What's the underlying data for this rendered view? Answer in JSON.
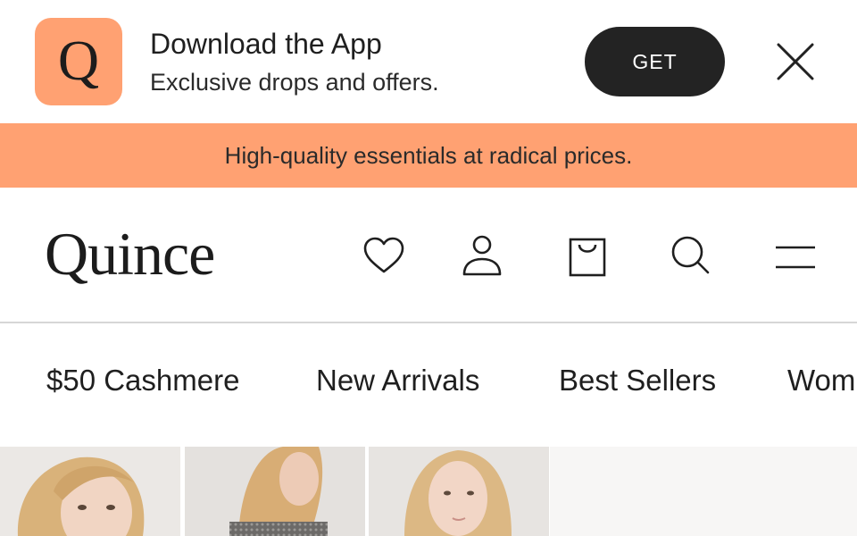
{
  "app_banner": {
    "logo_letter": "Q",
    "title": "Download the App",
    "subtitle": "Exclusive drops and offers.",
    "get_label": "GET",
    "accent_color": "#ffa172"
  },
  "promo": {
    "text": "High-quality essentials at radical prices."
  },
  "header": {
    "brand": "Quince",
    "icons": [
      "heart-icon",
      "user-icon",
      "shopping-bag-icon",
      "search-icon",
      "menu-icon"
    ]
  },
  "categories": [
    "$50 Cashmere",
    "New Arrivals",
    "Best Sellers",
    "Wom"
  ],
  "products": [
    {
      "image": "model-photo-1"
    },
    {
      "image": "model-photo-2"
    },
    {
      "image": "model-photo-3"
    }
  ]
}
